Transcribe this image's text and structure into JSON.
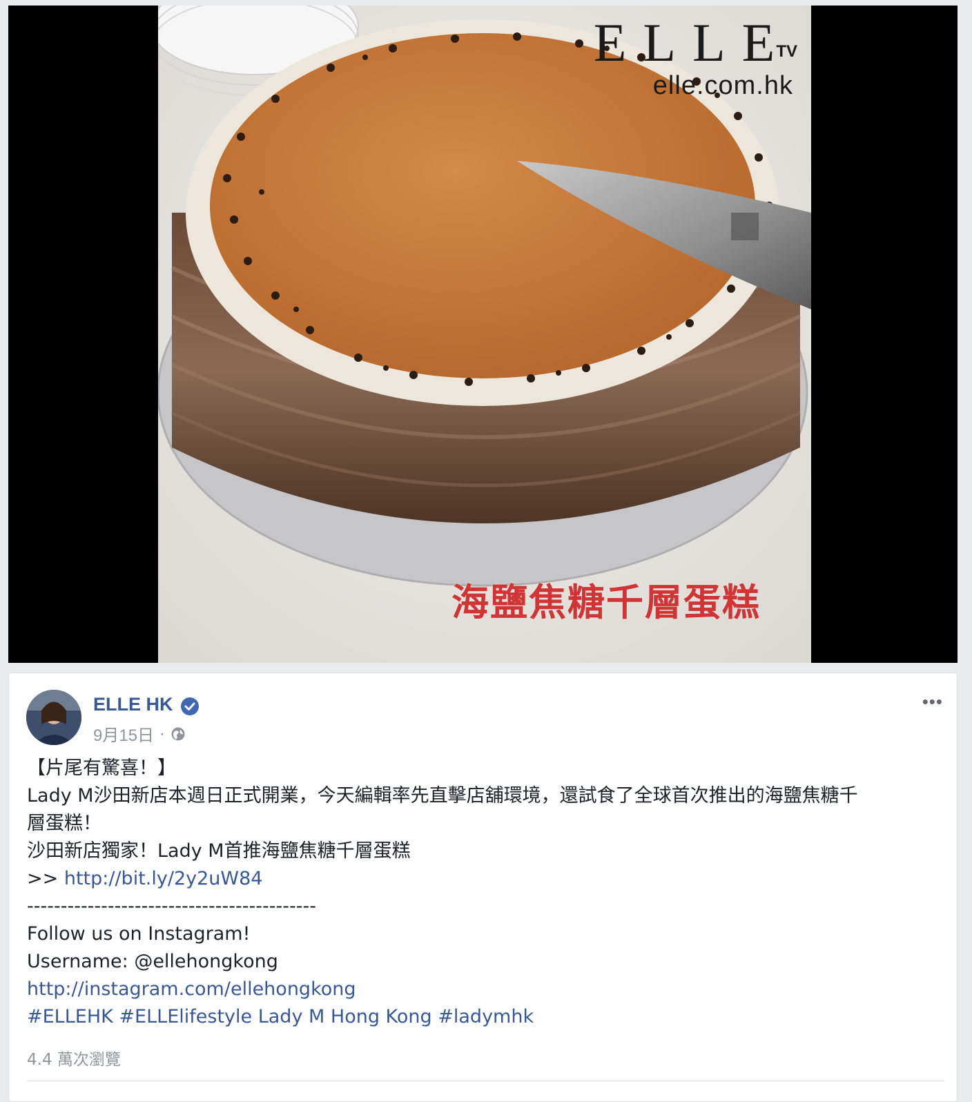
{
  "video": {
    "logo_brand": "ELLE",
    "logo_tv": "TV",
    "logo_site": "elle.com.hk",
    "overlay_caption": "海鹽焦糖千層蛋糕"
  },
  "post": {
    "page_name": "ELLE HK",
    "date": "9月15日",
    "separator": "·",
    "more_label": "•••",
    "lines": [
      "【片尾有驚喜！】",
      "Lady M沙田新店本週日正式開業，今天編輯率先直擊店舖環境，還試食了全球首次推出的海鹽焦糖千",
      "層蛋糕！",
      "沙田新店獨家！Lady M首推海鹽焦糖千層蛋糕"
    ],
    "link_prefix": ">> ",
    "link1": "http://bit.ly/2y2uW84",
    "dashes": "-------------------------------------------",
    "follow": "Follow us on Instagram!",
    "username": "Username: @ellehongkong",
    "link2": "http://instagram.com/ellehongkong",
    "hashtag1": "#ELLEHK",
    "hashtag2": "#ELLElifestyle",
    "hashtag_text": " Lady M Hong Kong ",
    "hashtag3": "#ladymhk",
    "views": "4.4 萬次瀏覽"
  },
  "colors": {
    "link": "#365899",
    "caption_red": "#d13434",
    "verified": "#4267b2"
  }
}
